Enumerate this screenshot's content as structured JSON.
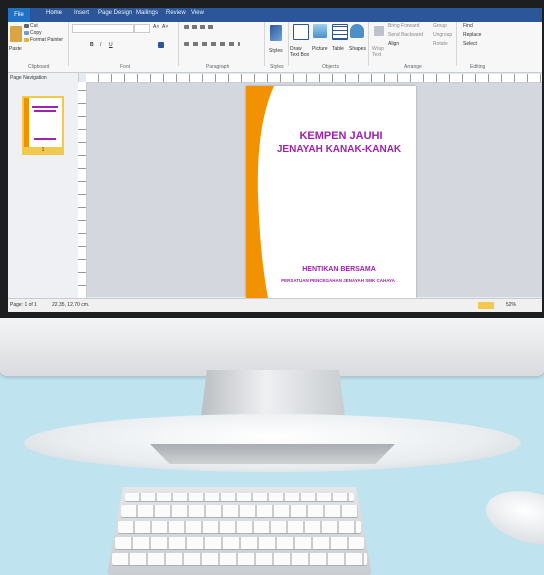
{
  "ribbon_tabs": {
    "file": "File",
    "home": "Home",
    "insert": "Insert",
    "page_design": "Page Design",
    "mailings": "Mailings",
    "review": "Review",
    "view": "View"
  },
  "clipboard": {
    "paste": "Paste",
    "cut": "Cut",
    "copy": "Copy",
    "format_painter": "Format Painter",
    "group": "Clipboard"
  },
  "font": {
    "group": "Font",
    "size_grow": "A˄",
    "size_shrink": "A˅",
    "bold": "B",
    "italic": "I",
    "underline": "U"
  },
  "paragraph": {
    "group": "Paragraph"
  },
  "styles": {
    "label": "Styles",
    "group": "Styles"
  },
  "objects": {
    "draw_text_box": "Draw\nText Box",
    "picture": "Picture",
    "table": "Table",
    "shapes": "Shapes",
    "group": "Objects"
  },
  "arrange": {
    "wrap_text": "Wrap\nText",
    "bring_forward": "Bring Forward",
    "send_backward": "Send Backward",
    "align": "Align",
    "group_btn": "Group",
    "ungroup": "Ungroup",
    "rotate": "Rotate",
    "group": "Arrange"
  },
  "editing": {
    "find": "Find",
    "replace": "Replace",
    "select": "Select",
    "group": "Editing"
  },
  "nav_pane": {
    "title": "Page Navigation",
    "page_num": "1"
  },
  "document": {
    "title_line1": "KEMPEN JAUHI",
    "title_line2": "JENAYAH KANAK-KANAK",
    "subtitle": "HENTIKAN BERSAMA",
    "org": "PERSATUAN PENCEGAHAN JENAYAH SMK CAHAYA"
  },
  "status": {
    "page": "Page: 1 of 1",
    "position": "22.35, 12.70 cm.",
    "zoom": "52%"
  },
  "colors": {
    "accent_purple": "#a020b0",
    "orange": "#f39200",
    "ribbon_blue": "#2b579a"
  }
}
